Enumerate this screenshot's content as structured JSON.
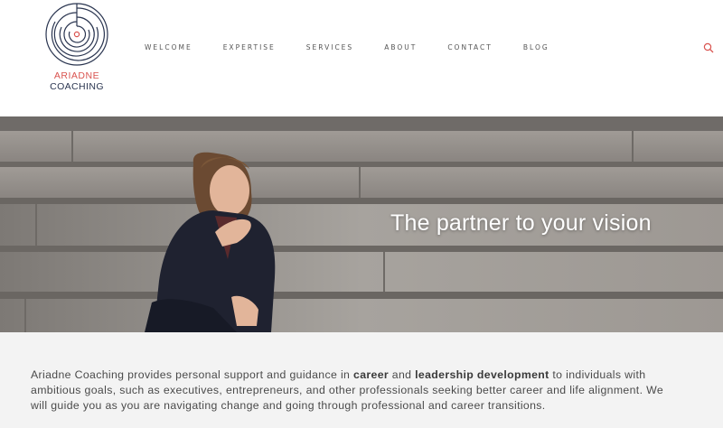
{
  "brand": {
    "name": "ARIADNE",
    "sub": "COACHING",
    "accent_color": "#d9534f",
    "navy_color": "#2a3550"
  },
  "nav": {
    "items": [
      {
        "label": "WELCOME"
      },
      {
        "label": "EXPERTISE"
      },
      {
        "label": "SERVICES"
      },
      {
        "label": "ABOUT"
      },
      {
        "label": "CONTACT"
      },
      {
        "label": "BLOG"
      }
    ],
    "search_icon": "search-icon"
  },
  "hero": {
    "title": "The partner to your vision"
  },
  "intro": {
    "part1": "Ariadne Coaching provides personal support and guidance in ",
    "bold1": "career",
    "part2": " and ",
    "bold2": "leadership development",
    "part3": " to individuals with ambitious goals, such as executives, entrepreneurs, and other professionals seeking better career and life alignment. We will guide you as you are navigating change and going through professional and career transitions."
  }
}
